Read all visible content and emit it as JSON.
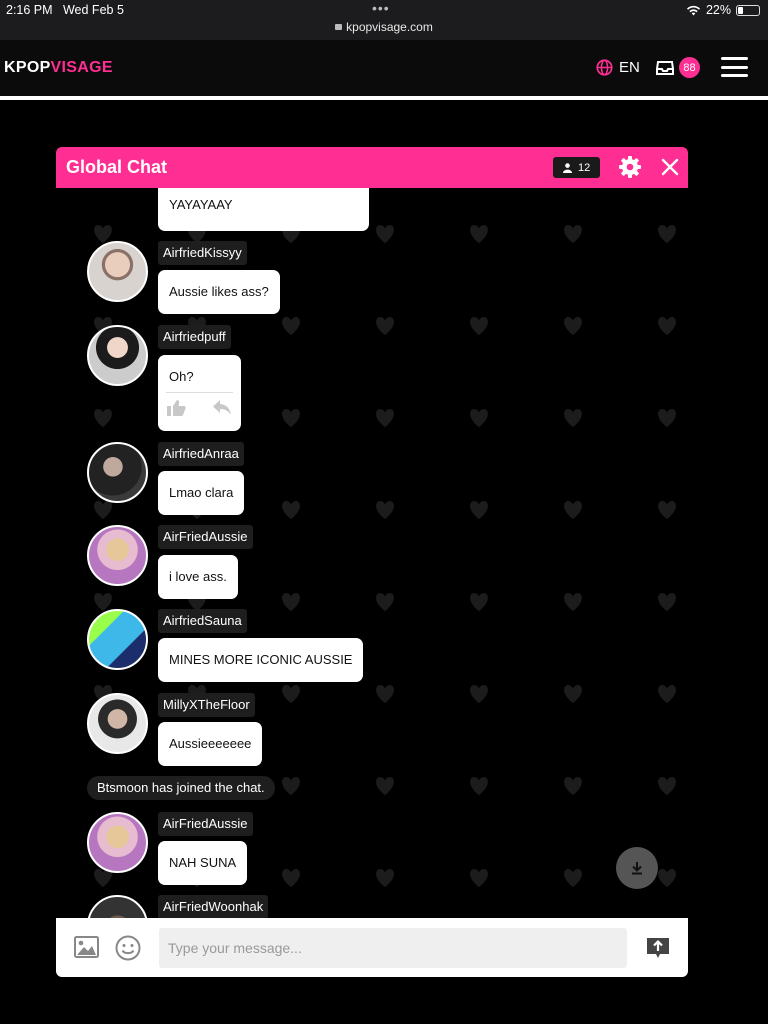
{
  "status_bar": {
    "time": "2:16 PM",
    "date": "Wed Feb 5",
    "url": "kpopvisage.com",
    "battery": "22%"
  },
  "site": {
    "logo_white": "KPOP",
    "logo_pink": "VISAGE",
    "language": "EN",
    "inbox_count": "88"
  },
  "colors": {
    "brand_pink": "#ff2e93"
  },
  "chat": {
    "title": "Global Chat",
    "member_count": "12",
    "input_placeholder": "Type your message...",
    "partial_top_message": "YAYAYAAY",
    "messages": [
      {
        "user": "AirfriedKissyy",
        "text": "Aussie likes ass?"
      },
      {
        "user": "Airfriedpuff",
        "text": "Oh?"
      },
      {
        "user": "AirfriedAnraa",
        "text": "Lmao clara"
      },
      {
        "user": "AirFriedAussie",
        "text": "i love ass."
      },
      {
        "user": "AirfriedSauna",
        "text": "MINES MORE ICONIC AUSSIE"
      },
      {
        "user": "MillyXTheFloor",
        "text": "Aussieeeeeee"
      },
      {
        "user": "AirFriedAussie",
        "text": "NAH SUNA"
      },
      {
        "user": "AirFriedWoonhak",
        "text": ""
      }
    ],
    "system_message": "Btsmoon has joined the chat."
  }
}
